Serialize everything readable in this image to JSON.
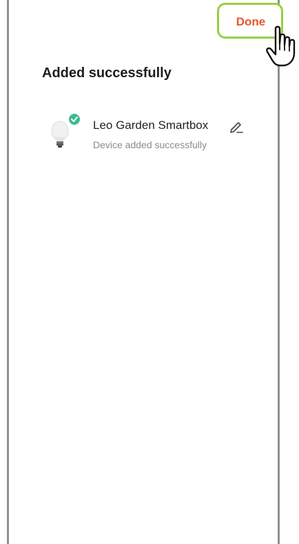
{
  "header": {
    "done_label": "Done"
  },
  "main": {
    "title": "Added successfully",
    "devices": [
      {
        "name": "Leo Garden Smartbox",
        "status": "Device added successfully",
        "icon": "light-bulb-icon",
        "badge_icon": "check-badge-icon",
        "badge_color": "#3dbb8e",
        "edit_icon": "pencil-icon"
      }
    ]
  },
  "annotation": {
    "cursor_icon": "hand-pointer-icon",
    "highlight_color": "#97cf3e"
  },
  "colors": {
    "accent": "#e8552a",
    "text_primary": "#1d1d1d",
    "text_secondary": "#8b8b8b",
    "success": "#3dbb8e"
  }
}
